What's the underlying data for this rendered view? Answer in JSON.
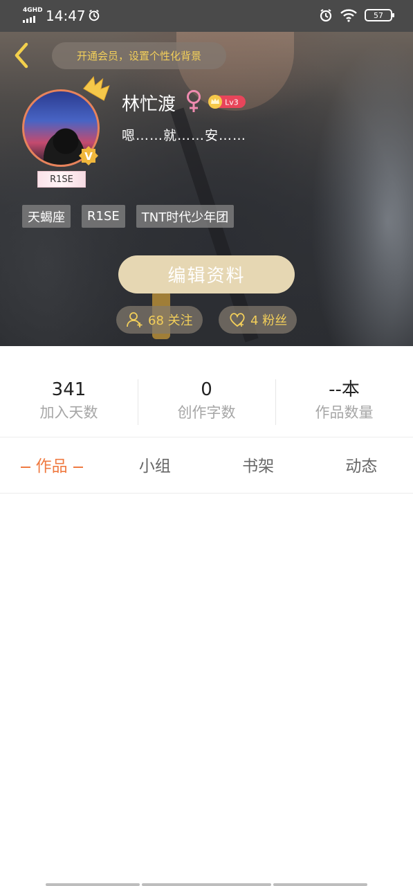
{
  "status_bar": {
    "network": "4GHD",
    "time": "14:47",
    "battery": "57"
  },
  "header": {
    "vip_prompt": "开通会员，设置个性化背景"
  },
  "profile": {
    "name": "林忙渡",
    "level": "Lv3",
    "bio": "嗯……就……安……",
    "avatar_tag": "R1SE",
    "verified_badge": "V",
    "tags": [
      "天蝎座",
      "R1SE",
      "TNT时代少年团"
    ],
    "edit_button": "编辑资料",
    "following": "68 关注",
    "followers": "4 粉丝"
  },
  "stats": [
    {
      "value": "341",
      "label": "加入天数"
    },
    {
      "value": "0",
      "label": "创作字数"
    },
    {
      "value": "--本",
      "label": "作品数量"
    }
  ],
  "tabs": [
    {
      "label": "作品",
      "active": true
    },
    {
      "label": "小组",
      "active": false
    },
    {
      "label": "书架",
      "active": false
    },
    {
      "label": "动态",
      "active": false
    }
  ],
  "colors": {
    "accent": "#ef7a41",
    "gold": "#f3cf5a",
    "edit_button_bg": "#e6d7b3",
    "avatar_ring": "#e7835c",
    "gender_female": "#f08bb0",
    "level_badge": "#e8455a"
  },
  "icons": [
    "back-icon",
    "alarm-icon",
    "wifi-icon",
    "battery-icon",
    "crown-icon",
    "verified-icon",
    "female-icon",
    "level-crown-icon",
    "follow-user-icon",
    "heart-icon"
  ]
}
